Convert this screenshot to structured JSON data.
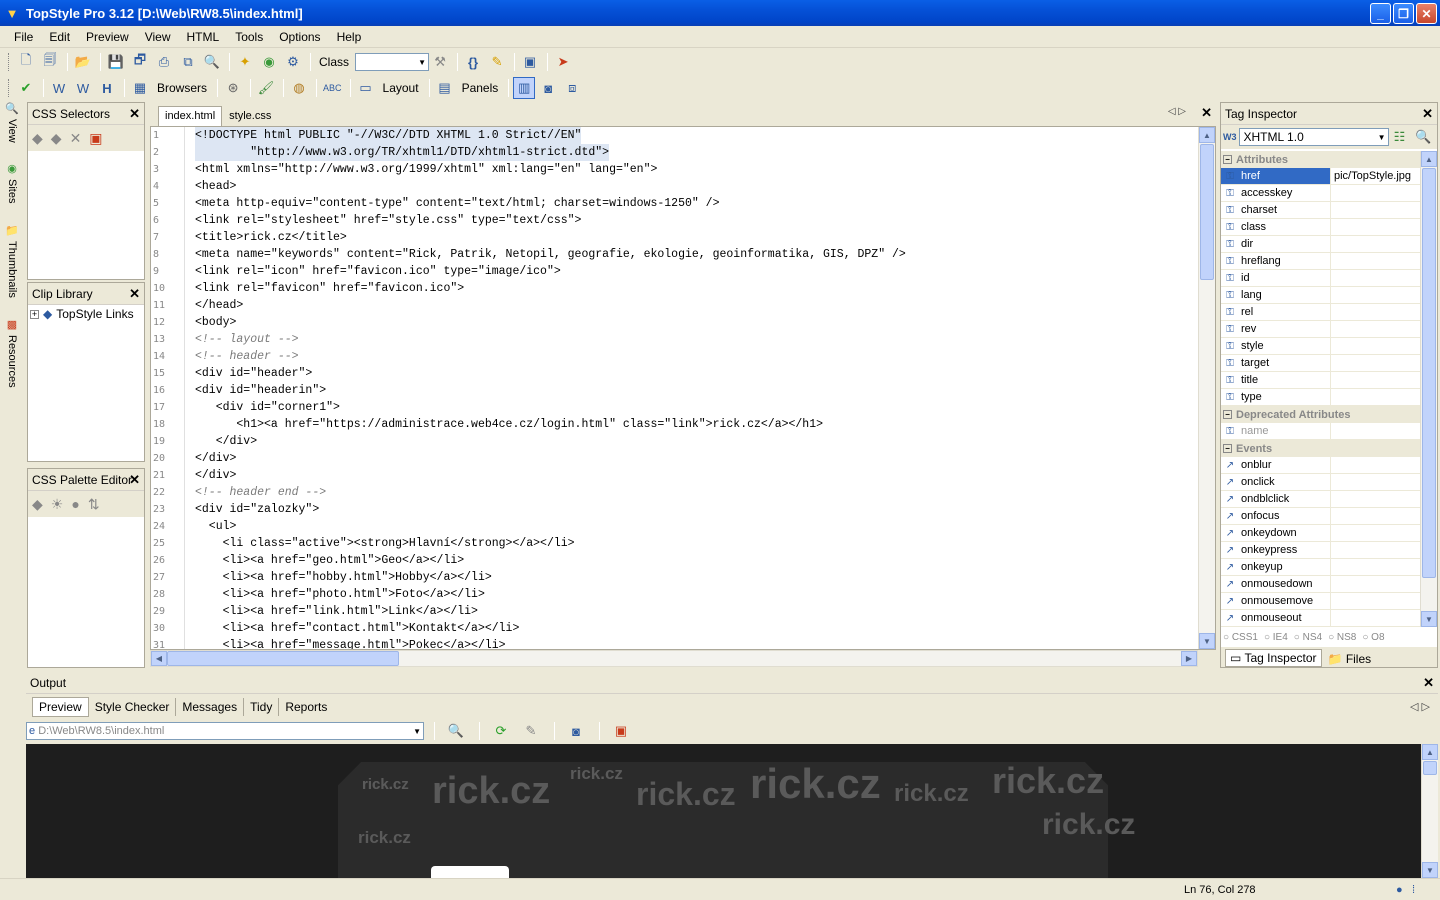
{
  "window": {
    "title": "TopStyle Pro 3.12  [D:\\Web\\RW8.5\\index.html]"
  },
  "menu": [
    "File",
    "Edit",
    "Preview",
    "View",
    "HTML",
    "Tools",
    "Options",
    "Help"
  ],
  "toolbar": {
    "class_label": "Class",
    "browsers": "Browsers",
    "layout": "Layout",
    "panels": "Panels"
  },
  "sidetabs": [
    "View",
    "Sites",
    "Thumbnails",
    "Resources"
  ],
  "panels": {
    "css_selectors": "CSS Selectors",
    "clip_library": "Clip Library",
    "clip_item": "TopStyle Links",
    "palette": "CSS Palette Editor"
  },
  "editor": {
    "tabs": [
      "index.html",
      "style.css"
    ],
    "lines": [
      "<!DOCTYPE html PUBLIC \"-//W3C//DTD XHTML 1.0 Strict//EN\"",
      "        \"http://www.w3.org/TR/xhtml1/DTD/xhtml1-strict.dtd\">",
      "<html xmlns=\"http://www.w3.org/1999/xhtml\" xml:lang=\"en\" lang=\"en\">",
      "<head>",
      "<meta http-equiv=\"content-type\" content=\"text/html; charset=windows-1250\" />",
      "<link rel=\"stylesheet\" href=\"style.css\" type=\"text/css\">",
      "<title>rick.cz</title>",
      "<meta name=\"keywords\" content=\"Rick, Patrik, Netopil, geografie, ekologie, geoinformatika, GIS, DPZ\" />",
      "<link rel=\"icon\" href=\"favicon.ico\" type=\"image/ico\">",
      "<link rel=\"favicon\" href=\"favicon.ico\">",
      "</head>",
      "<body>",
      "<!-- layout -->",
      "<!-- header -->",
      "<div id=\"header\">",
      "<div id=\"headerin\">",
      "   <div id=\"corner1\">",
      "      <h1><a href=\"https://administrace.web4ce.cz/login.html\" class=\"link\">rick.cz</a></h1>",
      "   </div>",
      "</div>",
      "</div>",
      "<!-- header end -->",
      "<div id=\"zalozky\">",
      "  <ul>",
      "    <li class=\"active\"><strong>Hlavní</strong></a></li>",
      "    <li><a href=\"geo.html\">Geo</a></li>",
      "    <li><a href=\"hobby.html\">Hobby</a></li>",
      "    <li><a href=\"photo.html\">Foto</a></li>",
      "    <li><a href=\"link.html\">Link</a></li>",
      "    <li><a href=\"contact.html\">Kontakt</a></li>",
      "    <li><a href=\"message.html\">Pokec</a></li>"
    ]
  },
  "inspector": {
    "title": "Tag Inspector",
    "doctype": "XHTML 1.0",
    "cat_attributes": "Attributes",
    "cat_deprecated": "Deprecated Attributes",
    "cat_events": "Events",
    "attributes": [
      {
        "name": "href",
        "value": "pic/TopStyle.jpg"
      },
      {
        "name": "accesskey",
        "value": ""
      },
      {
        "name": "charset",
        "value": ""
      },
      {
        "name": "class",
        "value": ""
      },
      {
        "name": "dir",
        "value": ""
      },
      {
        "name": "hreflang",
        "value": ""
      },
      {
        "name": "id",
        "value": ""
      },
      {
        "name": "lang",
        "value": ""
      },
      {
        "name": "rel",
        "value": ""
      },
      {
        "name": "rev",
        "value": ""
      },
      {
        "name": "style",
        "value": ""
      },
      {
        "name": "target",
        "value": ""
      },
      {
        "name": "title",
        "value": ""
      },
      {
        "name": "type",
        "value": ""
      }
    ],
    "deprecated": [
      "name"
    ],
    "events": [
      "onblur",
      "onclick",
      "ondblclick",
      "onfocus",
      "onkeydown",
      "onkeypress",
      "onkeyup",
      "onmousedown",
      "onmousemove",
      "onmouseout"
    ],
    "radios": [
      "CSS1",
      "IE4",
      "NS4",
      "NS8",
      "O8"
    ],
    "bottom_tabs": [
      "Tag Inspector",
      "Files"
    ]
  },
  "output": {
    "title": "Output",
    "tabs": [
      "Preview",
      "Style Checker",
      "Messages",
      "Tidy",
      "Reports"
    ],
    "path": "D:\\Web\\RW8.5\\index.html",
    "preview_words": [
      "rick.cz",
      "rick.cz",
      "rick.cz",
      "rick.cz",
      "rick.cz",
      "rick.cz",
      "rick.cz",
      "rick.cz",
      "rick.cz",
      "rick.c"
    ]
  },
  "status": {
    "position": "Ln 76, Col 278"
  }
}
